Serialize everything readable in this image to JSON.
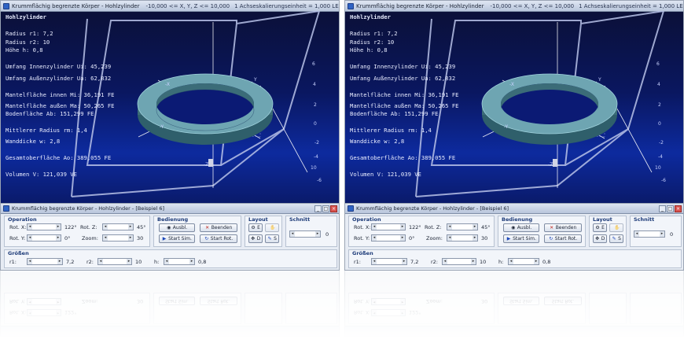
{
  "window": {
    "title": "Krummflächig begrenzte Körper - Hohlzylinder",
    "range": "-10,000 <= X, Y, Z <= 10,000",
    "unit": "1 Achseskalierungseinheit = 1,000 LE"
  },
  "info": {
    "heading": "Hohlzylinder",
    "radius1": "Radius r1: 7,2",
    "radius2": "Radius r2: 10",
    "height": "Höhe h: 0,8",
    "umfang_innen": "Umfang Innenzylinder Ui: 45,239",
    "umfang_aussen": "Umfang Außenzylinder Ua: 62,832",
    "mantel_innen": "Mantelfläche innen Mi: 36,191 FE",
    "mantel_aussen": "Mantelfläche außen Ma: 50,265 FE",
    "boden": "Bodenfläche Ab: 151,299 FE",
    "mittlerer_radius": "Mittlerer Radius rm: 1,4",
    "wanddicke": "Wanddicke w: 2,8",
    "gesamtoberflaeche": "Gesamtoberfläche Ao: 389,055 FE",
    "volumen": "Volumen V: 121,039 VE"
  },
  "axes": {
    "x_neg": "-X",
    "y_pos": "Y",
    "y_neg": "-Y",
    "z_neg": "-Z",
    "ticks": [
      "-6",
      "-4",
      "-2",
      "0",
      "2",
      "4",
      "6",
      "8",
      "10"
    ]
  },
  "panel": {
    "title": "Krummflächig begrenzte Körper - Hohlzylinder - [Beispiel 6]",
    "operation": {
      "label": "Operation",
      "rot_x_label": "Rot. X:",
      "rot_x_value": "122°",
      "rot_y_label": "Rot. Y:",
      "rot_y_value": "0°",
      "rot_z_label": "Rot. Z:",
      "rot_z_value": "45°",
      "zoom_label": "Zoom:",
      "zoom_value": "30"
    },
    "bedienung": {
      "label": "Bedienung",
      "ausbl": "Ausbl.",
      "beenden": "Beenden",
      "start_sim": "Start Sim.",
      "start_rot": "Start Rot."
    },
    "layout": {
      "label": "Layout",
      "btn_e": "E",
      "btn_d": "D",
      "btn_s": "S"
    },
    "schnitt": {
      "label": "Schnitt",
      "value": "0"
    },
    "groessen": {
      "label": "Größen",
      "r1_label": "r1:",
      "r1_value": "7,2",
      "r2_label": "r2:",
      "r2_value": "10",
      "h_label": "h:",
      "h_value": "0,8"
    }
  },
  "colors": {
    "accent": "#1c3a78",
    "ring_top": "#5d93a0",
    "ring_side": "#3b6c78",
    "background_dark": "#0a1760"
  }
}
